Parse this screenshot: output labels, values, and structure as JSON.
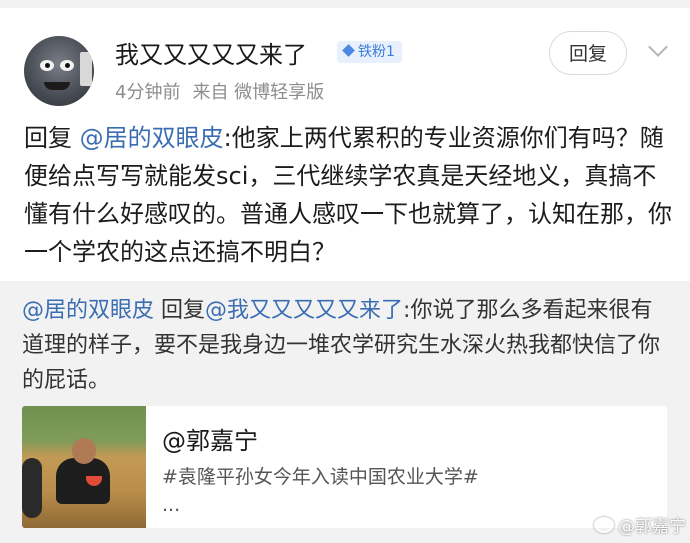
{
  "post": {
    "username": "我又又又又又来了",
    "badge": "铁粉1",
    "time": "4分钟前",
    "source": "来自 微博轻享版",
    "reply_label": "回复"
  },
  "comment": {
    "prefix": "回复 ",
    "mention": "@居的双眼皮",
    "text": ":他家上两代累积的专业资源你们有吗？随便给点写写就能发sci，三代继续学农真是天经地义，真搞不懂有什么好感叹的。普通人感叹一下也就算了，认知在那，你一个学农的这点还搞不明白？"
  },
  "quote": {
    "mention1": "@居的双眼皮",
    "middle": " 回复",
    "mention2": "@我又又又又又来了",
    "text": ":你说了那么多看起来很有道理的样子，要不是我身边一堆农学研究生水深火热我都快信了你的屁话。"
  },
  "card": {
    "title": "@郭嘉宁",
    "subtitle": "#袁隆平孙女今年入读中国农业大学#",
    "ellipsis": "..."
  },
  "watermark": "@郭嘉宁",
  "colors": {
    "link": "#3b6db3",
    "badge_bg": "#e7f0fc",
    "badge_text": "#3b7ddb",
    "quote_bg": "#f2f2f2"
  },
  "icons": {
    "avatar": "avatar-image",
    "badge": "diamond-icon",
    "chevron": "chevron-down-icon",
    "watermark": "weibo-logo-icon"
  }
}
